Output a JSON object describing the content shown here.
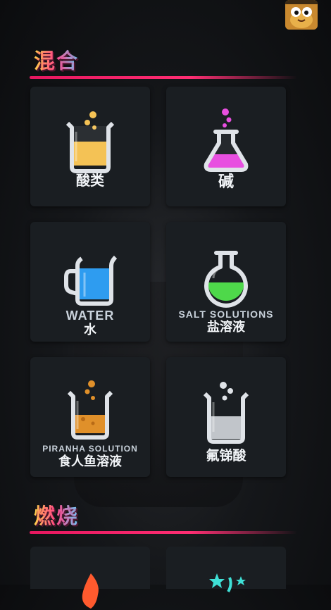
{
  "sections": {
    "mix_title": "混合",
    "burn_title": "燃烧"
  },
  "cards": {
    "acid": {
      "cn": "酸类",
      "icon": "beaker-icon",
      "liquid": "#f4c255"
    },
    "base": {
      "cn": "碱",
      "icon": "flask-icon",
      "liquid": "#e84fe0"
    },
    "water": {
      "en": "WATER",
      "cn": "水",
      "icon": "pitcher-icon",
      "liquid": "#2e9cf0"
    },
    "salt": {
      "en": "SALT SOLUTIONS",
      "cn": "盐溶液",
      "icon": "round-flask-icon",
      "liquid": "#4ed84a"
    },
    "piranha": {
      "en": "PIRANHA SOLUTION",
      "cn": "食人鱼溶液",
      "icon": "beaker-icon",
      "liquid": "#e0902a"
    },
    "fluoro": {
      "cn": "氟锑酸",
      "icon": "beaker-icon",
      "liquid": "#dfe3e8"
    }
  },
  "colors": {
    "accent": "#ff2e73",
    "card_bg": "#1a1e22",
    "glass": "#dfe3e8"
  },
  "avatar": {
    "icon": "avatar-icon"
  },
  "burn_items": [
    {
      "icon": "flame-icon",
      "color": "#ff5a2e"
    },
    {
      "icon": "sparkle-icon",
      "color": "#3fe0d6"
    }
  ]
}
